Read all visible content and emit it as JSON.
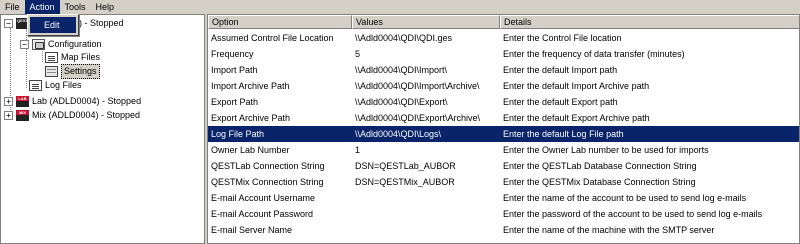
{
  "menu": {
    "items": [
      {
        "label": "File"
      },
      {
        "label": "Action"
      },
      {
        "label": "Tools"
      },
      {
        "label": "Help"
      }
    ],
    "dropdown_item": "Edit"
  },
  "tree": {
    "root1_label": "(ADLD0004) - Stopped",
    "configuration_label": "Configuration",
    "map_files_label": "Map Files",
    "settings_label": "Settings",
    "log_files_label": "Log Files",
    "root2_label": "Lab (ADLD0004) - Stopped",
    "root3_label": "Mix (ADLD0004) - Stopped",
    "icon_text_top": "QEST",
    "icon_text_lab": "LAB",
    "icon_text_mix": "MIX"
  },
  "table": {
    "columns": [
      "Option",
      "Values",
      "Details"
    ],
    "rows": [
      [
        "Assumed Control File Location",
        "\\\\Adld0004\\QDI\\QDI.ges",
        "Enter the Control File location"
      ],
      [
        "Frequency",
        "5",
        "Enter the frequency of data transfer (minutes)"
      ],
      [
        "Import Path",
        "\\\\Adld0004\\QDI\\Import\\",
        "Enter the default Import path"
      ],
      [
        "Import Archive Path",
        "\\\\Adld0004\\QDI\\Import\\Archive\\",
        "Enter the default Import Archive path"
      ],
      [
        "Export Path",
        "\\\\Adld0004\\QDI\\Export\\",
        "Enter the default Export path"
      ],
      [
        "Export Archive Path",
        "\\\\Adld0004\\QDI\\Export\\Archive\\",
        "Enter the default Export Archive path"
      ],
      [
        "Log File Path",
        "\\\\Adld0004\\QDI\\Logs\\",
        "Enter the default Log File path"
      ],
      [
        "Owner Lab Number",
        "1",
        "Enter the Owner Lab number to be used for imports"
      ],
      [
        "QESTLab Connection String",
        "DSN=QESTLab_AUBOR",
        "Enter the QESTLab Database Connection String"
      ],
      [
        "QESTMix Connection String",
        "DSN=QESTMix_AUBOR",
        "Enter the QESTMix Database Connection String"
      ],
      [
        "E-mail Account Username",
        "",
        "Enter the name of the account to be used to send log e-mails"
      ],
      [
        "E-mail Account Password",
        "",
        "Enter the password of the account to be used to send log e-mails"
      ],
      [
        "E-mail Server Name",
        "",
        "Enter the name of the machine with the SMTP server"
      ]
    ],
    "selected_row": 6
  }
}
